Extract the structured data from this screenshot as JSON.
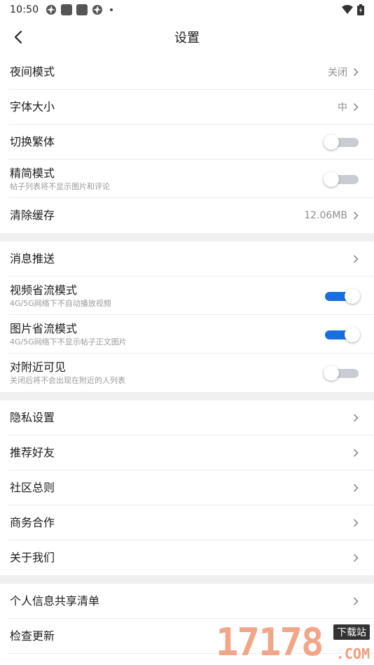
{
  "status_bar": {
    "time": "10:50"
  },
  "header": {
    "title": "设置"
  },
  "sections": [
    [
      {
        "key": "night_mode",
        "label": "夜间模式",
        "value": "关闭",
        "type": "nav"
      },
      {
        "key": "font_size",
        "label": "字体大小",
        "value": "中",
        "type": "nav"
      },
      {
        "key": "traditional",
        "label": "切换繁体",
        "type": "toggle",
        "on": false
      },
      {
        "key": "lite_mode",
        "label": "精简模式",
        "sub": "帖子列表将不显示图片和评论",
        "type": "toggle",
        "on": false
      },
      {
        "key": "clear_cache",
        "label": "清除缓存",
        "value": "12.06MB",
        "type": "nav"
      }
    ],
    [
      {
        "key": "push",
        "label": "消息推送",
        "type": "nav"
      },
      {
        "key": "video_saver",
        "label": "视频省流模式",
        "sub": "4G/5G网络下不自动播放视频",
        "type": "toggle",
        "on": true
      },
      {
        "key": "image_saver",
        "label": "图片省流模式",
        "sub": "4G/5G网络下不显示帖子正文图片",
        "type": "toggle",
        "on": true
      },
      {
        "key": "nearby_visible",
        "label": "对附近可见",
        "sub": "关闭后将不会出现在附近的人列表",
        "type": "toggle",
        "on": false
      }
    ],
    [
      {
        "key": "privacy",
        "label": "隐私设置",
        "type": "nav"
      },
      {
        "key": "recommend_friends",
        "label": "推荐好友",
        "type": "nav"
      },
      {
        "key": "community_rules",
        "label": "社区总则",
        "type": "nav"
      },
      {
        "key": "business",
        "label": "商务合作",
        "type": "nav"
      },
      {
        "key": "about",
        "label": "关于我们",
        "type": "nav"
      }
    ],
    [
      {
        "key": "info_share",
        "label": "个人信息共享清单",
        "type": "nav"
      },
      {
        "key": "check_update",
        "label": "检查更新",
        "type": "nav"
      }
    ]
  ],
  "watermark": {
    "number": "17178",
    "tag": "下载站",
    "suffix": ".COM"
  },
  "colors": {
    "accent": "#1a6fe0",
    "toggle_off": "#c9ccd3",
    "divider": "#ececec",
    "section_gap": "#f0f0f0"
  }
}
